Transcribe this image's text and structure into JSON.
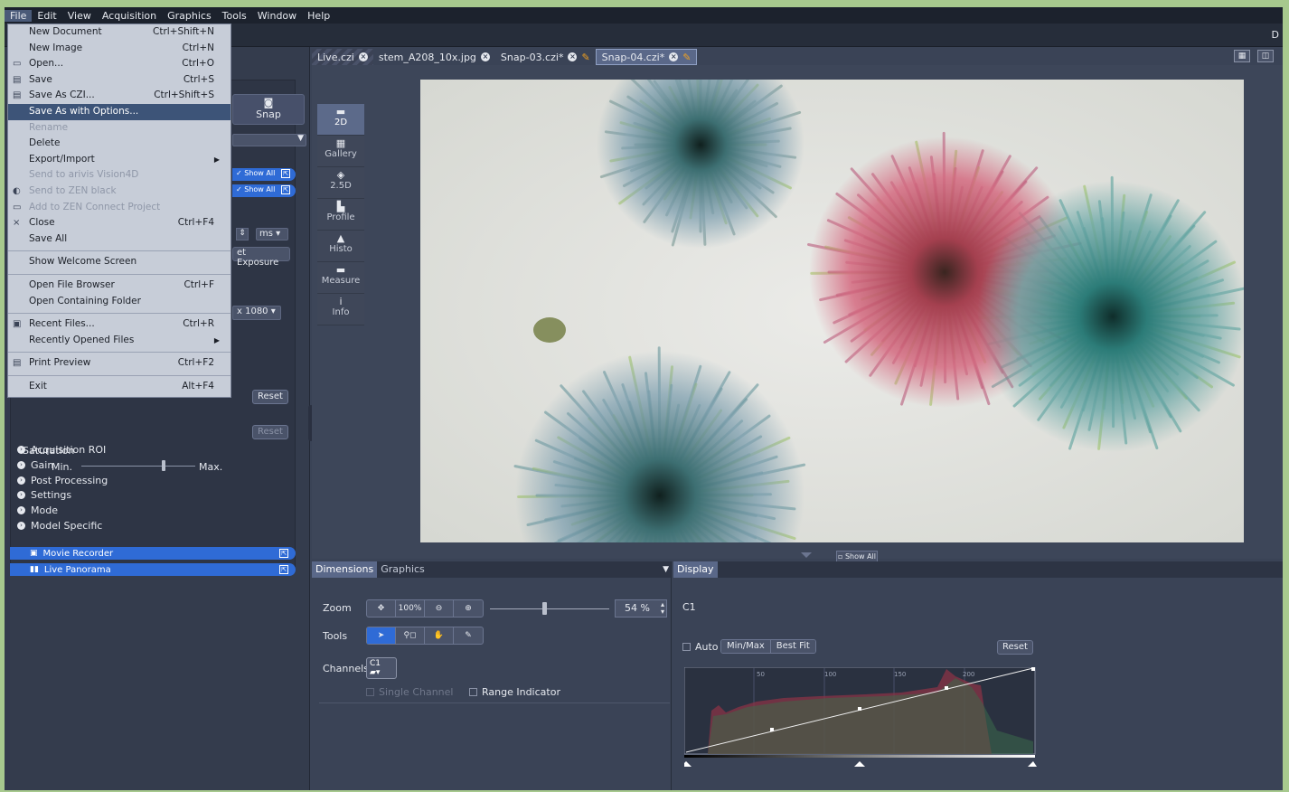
{
  "menubar": [
    "File",
    "Edit",
    "View",
    "Acquisition",
    "Graphics",
    "Tools",
    "Window",
    "Help"
  ],
  "topstrip_corner": "D",
  "file_menu": [
    {
      "label": "New Document",
      "shortcut": "Ctrl+Shift+N"
    },
    {
      "label": "New Image",
      "shortcut": "Ctrl+N"
    },
    {
      "label": "Open...",
      "shortcut": "Ctrl+O",
      "icon": "folder-icon"
    },
    {
      "label": "Save",
      "shortcut": "Ctrl+S",
      "icon": "save-icon"
    },
    {
      "label": "Save As CZI...",
      "shortcut": "Ctrl+Shift+S",
      "icon": "save-as-icon"
    },
    {
      "label": "Save As with Options...",
      "shortcut": "",
      "highlighted": true
    },
    {
      "label": "Rename",
      "shortcut": "",
      "disabled": true
    },
    {
      "label": "Delete",
      "shortcut": ""
    },
    {
      "label": "Export/Import",
      "shortcut": "",
      "submenu": true
    },
    {
      "label": "Send to arivis Vision4D",
      "shortcut": "",
      "disabled": true
    },
    {
      "label": "Send to ZEN black",
      "shortcut": "",
      "disabled": true,
      "icon": "zen-icon"
    },
    {
      "label": "Add to ZEN Connect Project",
      "shortcut": "",
      "disabled": true,
      "icon": "connect-icon"
    },
    {
      "label": "Close",
      "shortcut": "Ctrl+F4",
      "icon": "close-x-icon"
    },
    {
      "label": "Save All",
      "shortcut": ""
    },
    {
      "sep": true
    },
    {
      "label": "Show Welcome Screen",
      "shortcut": ""
    },
    {
      "sep": true
    },
    {
      "label": "Open File Browser",
      "shortcut": "Ctrl+F"
    },
    {
      "label": "Open Containing Folder",
      "shortcut": ""
    },
    {
      "sep": true
    },
    {
      "label": "Recent Files...",
      "shortcut": "Ctrl+R",
      "icon": "recent-icon"
    },
    {
      "label": "Recently Opened Files",
      "shortcut": "",
      "submenu": true
    },
    {
      "sep": true
    },
    {
      "label": "Print Preview",
      "shortcut": "Ctrl+F2",
      "icon": "print-preview-icon"
    },
    {
      "sep": true
    },
    {
      "label": "Exit",
      "shortcut": "Alt+F4"
    }
  ],
  "left": {
    "snap": "Snap",
    "show_all_1": "Show All",
    "show_all_2": "Show All",
    "unit": "ms",
    "set_exposure": "et Exposure",
    "resolution": "x 1080",
    "reset1": "Reset",
    "reset2": "Reset",
    "saturation": "Saturation",
    "min": "Min.",
    "max": "Max.",
    "sections": [
      "Acquisition ROI",
      "Gain",
      "Post Processing",
      "Settings",
      "Mode",
      "Model Specific"
    ],
    "tools": [
      "Movie Recorder",
      "Live Panorama"
    ]
  },
  "doc_tabs": [
    {
      "label": "Live.czi",
      "style": "live"
    },
    {
      "label": "stem_A208_10x.jpg",
      "style": "normal"
    },
    {
      "label": "Snap-03.czi*",
      "style": "normal"
    },
    {
      "label": "Snap-04.czi*",
      "style": "active"
    }
  ],
  "view_tabs": [
    {
      "label": "2D",
      "glyph": "▬",
      "active": true
    },
    {
      "label": "Gallery",
      "glyph": "▦"
    },
    {
      "label": "2.5D",
      "glyph": "◈"
    },
    {
      "label": "Profile",
      "glyph": "▙"
    },
    {
      "label": "Histo",
      "glyph": "▲"
    },
    {
      "label": "Measure",
      "glyph": "▬"
    },
    {
      "label": "Info",
      "glyph": "i"
    }
  ],
  "show_all_bottom": "Show All",
  "dimensions": {
    "tab1": "Dimensions",
    "tab2": "Graphics",
    "zoom_label": "Zoom",
    "zoom_buttons": [
      "✥",
      "100%",
      "⊖",
      "⊕"
    ],
    "zoom_value": "54 %",
    "zoom_level": 0.54,
    "tools_label": "Tools",
    "tool_buttons": [
      "➤",
      "⚲◻",
      "✋",
      "✎"
    ],
    "channels_label": "Channels",
    "channel": "C1",
    "single_channel": "Single Channel",
    "range_indicator": "Range Indicator"
  },
  "display": {
    "tab": "Display",
    "channel": "C1",
    "auto": "Auto",
    "minmax": "Min/Max",
    "bestfit": "Best Fit",
    "reset": "Reset",
    "histogram_ticks": [
      "50",
      "100",
      "150",
      "200"
    ]
  }
}
